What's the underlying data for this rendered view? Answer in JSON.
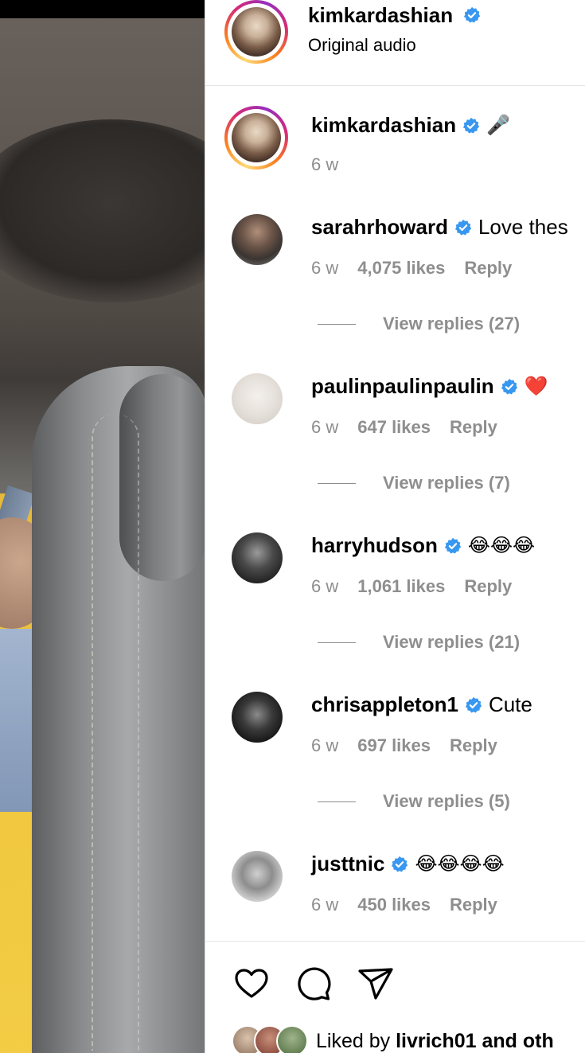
{
  "post": {
    "author": "kimkardashian",
    "audio_label": "Original audio",
    "caption_emoji": "🎤",
    "caption_time": "6 w"
  },
  "comments": [
    {
      "user": "sarahrhoward",
      "text": "Love thes",
      "time": "6 w",
      "likes": "4,075 likes",
      "reply_label": "Reply",
      "view_replies": "View replies (27)"
    },
    {
      "user": "paulinpaulinpaulin",
      "text": "❤️",
      "time": "6 w",
      "likes": "647 likes",
      "reply_label": "Reply",
      "view_replies": "View replies (7)"
    },
    {
      "user": "harryhudson",
      "text": "😂😂😂",
      "time": "6 w",
      "likes": "1,061 likes",
      "reply_label": "Reply",
      "view_replies": "View replies (21)"
    },
    {
      "user": "chrisappleton1",
      "text": "Cute",
      "time": "6 w",
      "likes": "697 likes",
      "reply_label": "Reply",
      "view_replies": "View replies (5)"
    },
    {
      "user": "justtnic",
      "text": "😂😂😂😂",
      "time": "6 w",
      "likes": "450 likes",
      "reply_label": "Reply"
    }
  ],
  "footer": {
    "liked_prefix": "Liked by",
    "liked_user": "livrich01",
    "liked_suffix": "and oth"
  },
  "icons": {
    "verified": "verified-badge-icon",
    "like": "heart-icon",
    "comment": "comment-bubble-icon",
    "share": "paper-plane-icon"
  },
  "colors": {
    "verified_blue": "#3897f0",
    "muted_text": "#8e8e8e",
    "divider": "#e4e4e4"
  }
}
